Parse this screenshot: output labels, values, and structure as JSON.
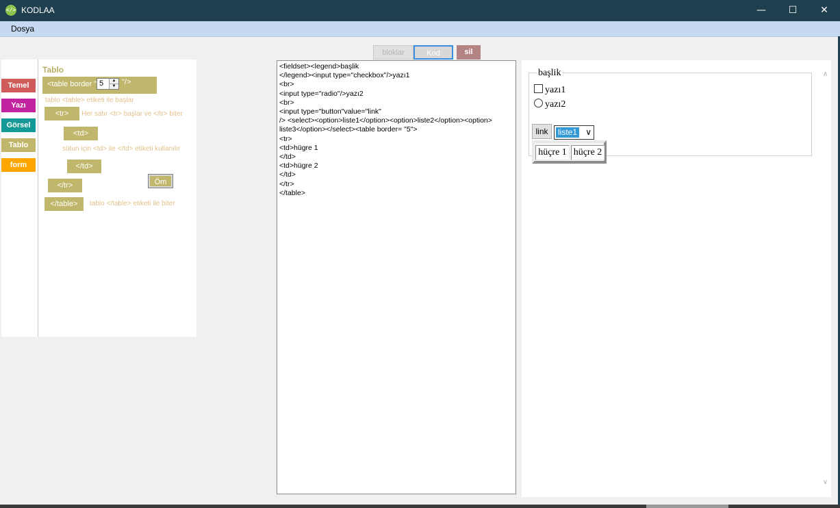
{
  "window": {
    "title": "KODLAA",
    "icon": "code-icon",
    "controls": {
      "minimize": "—",
      "maximize": "☐",
      "close": "✕"
    }
  },
  "menu": {
    "items": [
      {
        "label": "Dosya"
      }
    ]
  },
  "tabs": {
    "blocks": "bloklar",
    "code": "Kod",
    "delete": "sil"
  },
  "categories": [
    {
      "label": "Temel",
      "color": "#cf5b5b"
    },
    {
      "label": "Yazı",
      "color": "#c2239e"
    },
    {
      "label": "Görsel",
      "color": "#139a96"
    },
    {
      "label": "Tablo",
      "color": "#c0b76c"
    },
    {
      "label": "form",
      "color": "#ffa500"
    }
  ],
  "panel": {
    "title": "Tablo",
    "table_block": {
      "prefix": "<table border \"",
      "value": "5",
      "suffix": "\"/>"
    },
    "hint_table": "tablo <table> etiketi ile başlar",
    "tr_block": "<tr>",
    "hint_tr": "Her satır <tr> başlar ve </tr> biter",
    "td_block": "<td>",
    "hint_td": "sütun için <td> ile </td> etiketi kullanılır",
    "td_close_block": "</td>",
    "tr_close_block": "</tr>",
    "table_close_block": "</table>",
    "hint_table_close": "tablo </table> etiketi ile biter",
    "om_button": "Öm"
  },
  "code": "<fieldset><legend>başlik\n</legend><input type=\"checkbox\"/>yazı1\n<br>\n<input type=\"radio\"/>yazı2\n<br>\n<input type=\"button\"value=\"link\"\n/> <select><option>liste1</option><option>liste2</option><option>\nliste3</option></select><table border= \"5\">\n<tr>\n<td>hügre 1\n</td>\n<td>hügre 2\n</td>\n</tr>\n</table>",
  "preview": {
    "legend": "başlik",
    "checkbox_label": "yazı1",
    "radio_label": "yazı2",
    "button_label": "link",
    "select_value": "liste1",
    "cells": [
      "hüçre 1",
      "hüçre 2"
    ]
  }
}
